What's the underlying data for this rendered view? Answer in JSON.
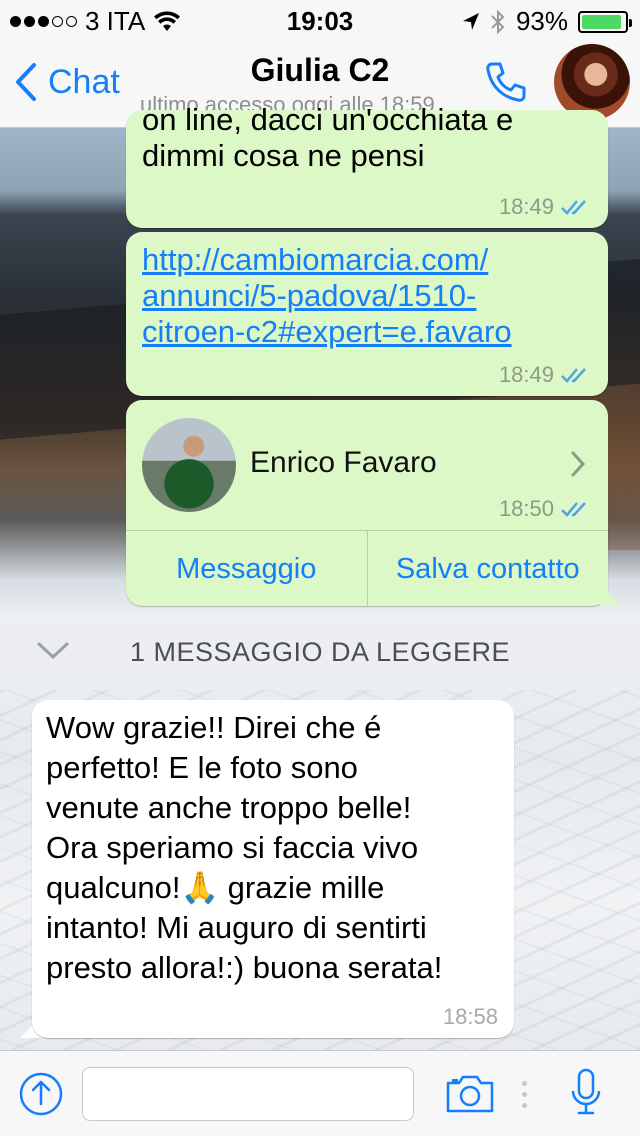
{
  "status_bar": {
    "carrier": "3 ITA",
    "time": "19:03",
    "battery": "93%",
    "battery_level": 0.93,
    "signal_bars_filled": 3,
    "signal_bars_total": 5
  },
  "header": {
    "back_label": "Chat",
    "contact_name": "Giulia C2",
    "last_seen": "ultimo accesso oggi alle 18:59"
  },
  "messages": [
    {
      "type": "outgoing",
      "text_lines": [
        "on line, dacci un'occhiata e",
        "dimmi cosa ne pensi"
      ],
      "time": "18:49"
    },
    {
      "type": "outgoing-link",
      "link_lines": [
        "http://cambiomarcia.com/",
        "annunci/5-padova/1510-",
        "citroen-c2#expert=e.favaro"
      ],
      "time": "18:49"
    },
    {
      "type": "outgoing-contact",
      "contact_name": "Enrico Favaro",
      "time": "18:50",
      "action_message": "Messaggio",
      "action_save": "Salva contatto"
    },
    {
      "type": "incoming",
      "text_lines": [
        "Wow grazie!! Direi che é",
        "perfetto! E le foto sono",
        "venute anche troppo belle!",
        "Ora speriamo si faccia vivo",
        "qualcuno!🙏 grazie mille",
        "intanto! Mi auguro di sentirti",
        "presto allora!:) buona serata!"
      ],
      "time": "18:58"
    }
  ],
  "unread_banner": "1 MESSAGGIO DA LEGGERE",
  "input": {
    "placeholder": ""
  },
  "colors": {
    "accent": "#157efb",
    "outgoing_bubble": "#dcf8c6",
    "incoming_bubble": "#ffffff",
    "read_ticks": "#4fa3e6"
  }
}
